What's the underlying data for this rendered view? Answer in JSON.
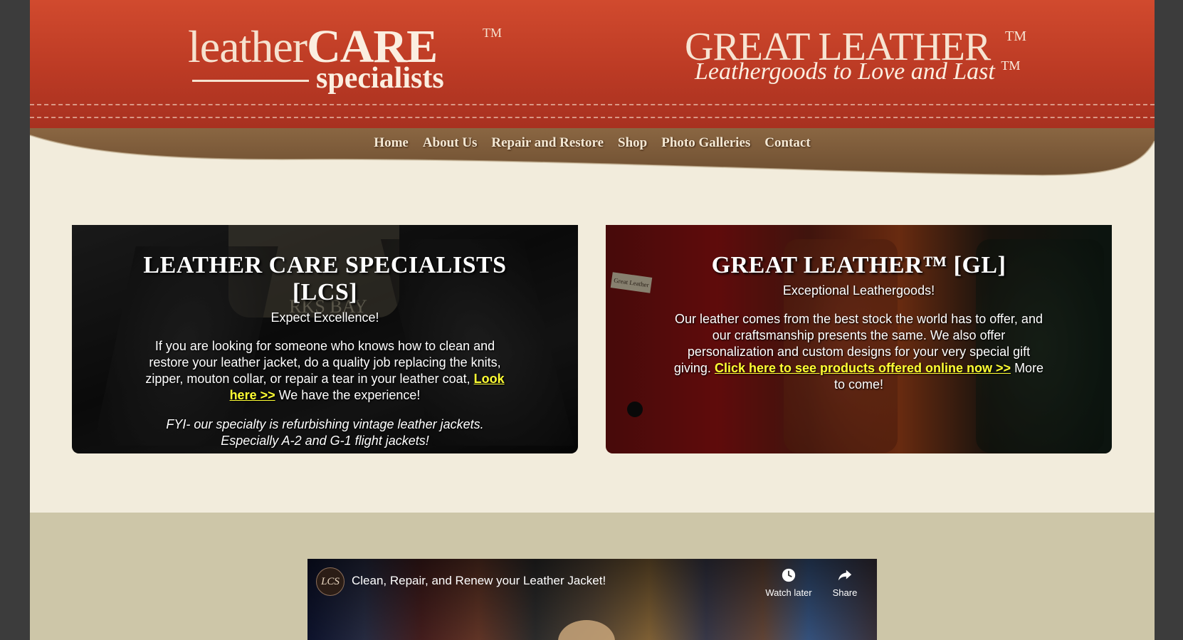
{
  "header": {
    "left_brand": {
      "part1": "leather",
      "part2": "CARE",
      "tm": "TM",
      "sub": "specialists"
    },
    "right_brand": {
      "main": "GREAT LEATHER",
      "tm": "TM",
      "tagline": "Leathergoods to Love and Last",
      "tagline_tm": "TM"
    }
  },
  "nav": {
    "items": [
      "Home",
      "About Us",
      "Repair and Restore",
      "Shop",
      "Photo Galleries",
      "Contact"
    ]
  },
  "cards": {
    "lcs": {
      "title": "LEATHER CARE SPECIALISTS [LCS]",
      "subtitle": "Expect Excellence!",
      "body": "If you are looking for someone who knows how to clean and restore your leather jacket, do a quality job replacing the knits, zipper, mouton collar, or repair a tear in your leather coat,",
      "link": "Look here >>",
      "body_tail": "We have the experience!",
      "note_line1": "FYI- our specialty is refurbishing vintage leather jackets.",
      "note_line2": "Especially A-2 and G-1 flight jackets!",
      "patch_text": "RKS BAY"
    },
    "gl": {
      "title": "GREAT LEATHER™ [GL]",
      "subtitle": "Exceptional Leathergoods!",
      "body": "Our leather comes from the best stock the world has to offer, and our craftsmanship presents the same. We also offer personalization and custom designs for your very special gift giving.",
      "link": "Click here to see products offered online now >>",
      "body_tail": "More to come!",
      "tag_text": "Great Leather"
    }
  },
  "video": {
    "avatar_text": "LCS",
    "title": "Clean, Repair, and Renew your Leather Jacket!",
    "watch_later": "Watch later",
    "share": "Share"
  },
  "colors": {
    "header_red": "#bb3a24",
    "nav_brown": "#7b5a3a",
    "page_cream": "#f2ecdc",
    "band_tan": "#cdc6a8",
    "link_yellow": "#ffff33"
  }
}
